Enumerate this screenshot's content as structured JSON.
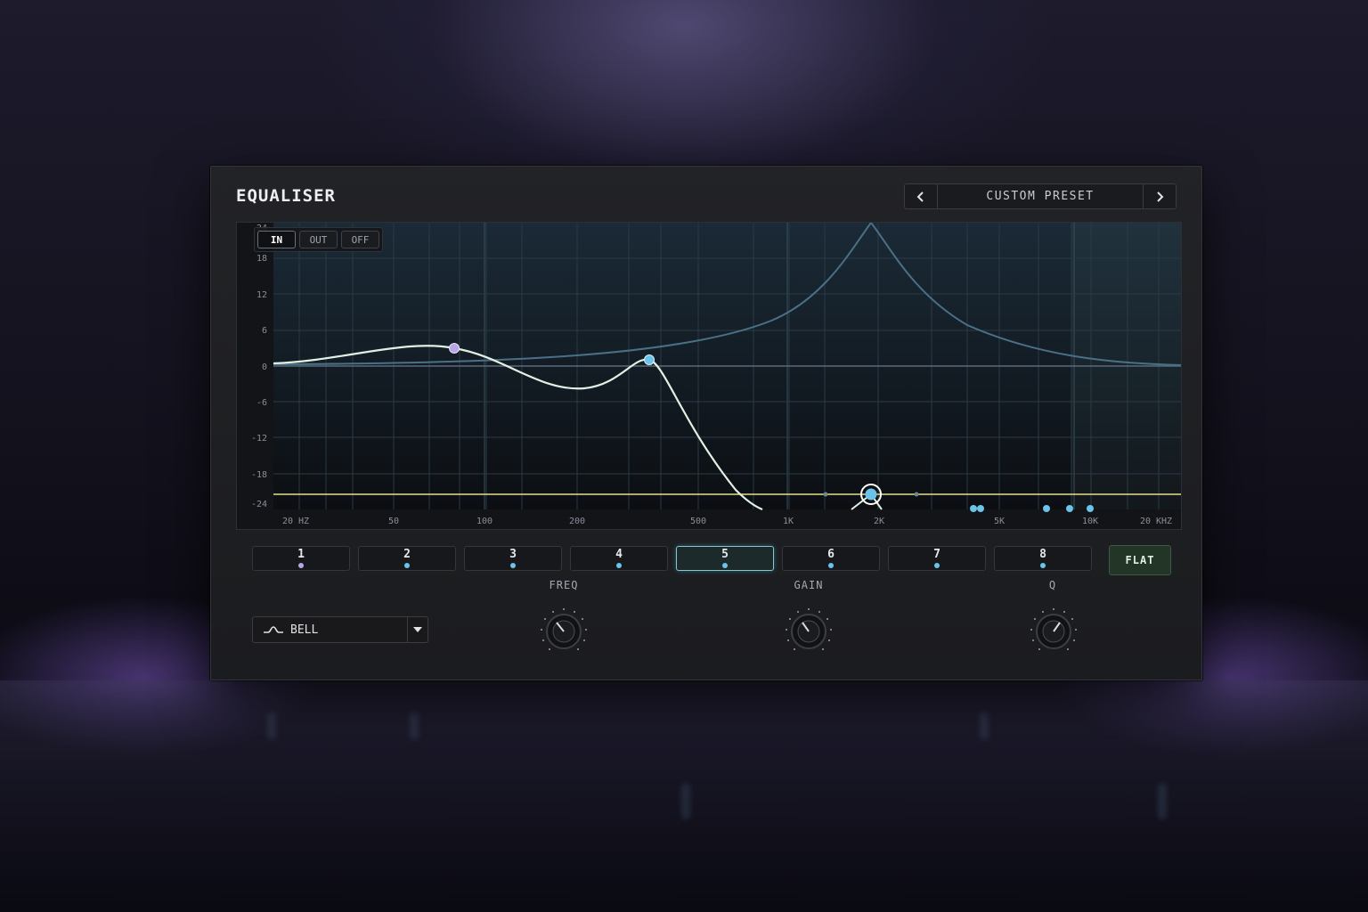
{
  "app": {
    "title": "EQUALISER",
    "accent_color": "#7ec8d8",
    "flat_color": "#233526"
  },
  "preset": {
    "name": "CUSTOM PRESET",
    "prev_icon": "chevron-left-icon",
    "next_icon": "chevron-right-icon"
  },
  "graph": {
    "modes": [
      "IN",
      "OUT",
      "OFF"
    ],
    "active_mode": "IN",
    "y_ticks": [
      "24",
      "18",
      "12",
      "6",
      "0",
      "-6",
      "-12",
      "-18",
      "-24"
    ],
    "x_ticks": [
      "20 HZ",
      "50",
      "100",
      "200",
      "500",
      "1K",
      "2K",
      "5K",
      "10K",
      "20 KHZ"
    ]
  },
  "bands": [
    {
      "label": "1",
      "color": "#b9a6e6"
    },
    {
      "label": "2",
      "color": "#6cc3ea"
    },
    {
      "label": "3",
      "color": "#6cc3ea"
    },
    {
      "label": "4",
      "color": "#6cc3ea"
    },
    {
      "label": "5",
      "color": "#6cc3ea"
    },
    {
      "label": "6",
      "color": "#6cc3ea"
    },
    {
      "label": "7",
      "color": "#6cc3ea"
    },
    {
      "label": "8",
      "color": "#6cc3ea"
    }
  ],
  "selected_band": "5",
  "flat_label": "FLAT",
  "filter": {
    "type_label": "BELL",
    "icon": "bell-curve-icon"
  },
  "params": {
    "freq_label": "FREQ",
    "gain_label": "GAIN",
    "q_label": "Q"
  }
}
